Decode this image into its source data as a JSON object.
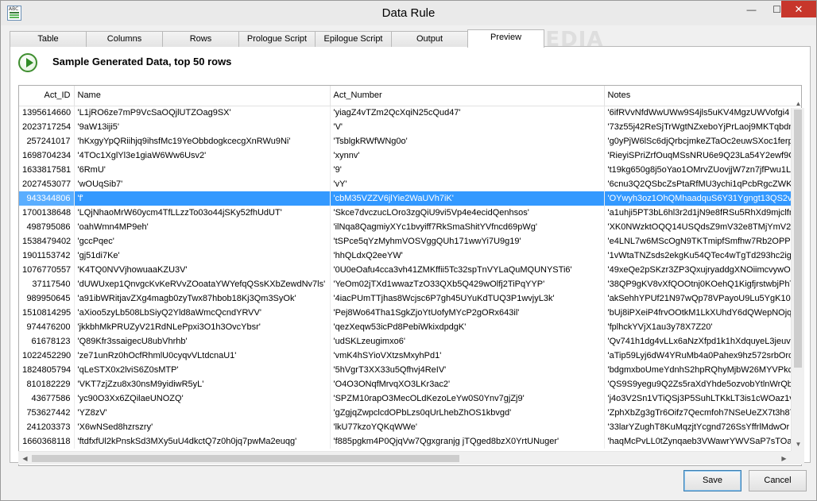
{
  "window": {
    "title": "Data Rule",
    "icon": "abc-grid-icon",
    "controls": {
      "minimize": "—",
      "maximize": "☐",
      "close": "✕"
    }
  },
  "tabs": [
    {
      "label": "Table",
      "active": false
    },
    {
      "label": "Columns",
      "active": false
    },
    {
      "label": "Rows",
      "active": false
    },
    {
      "label": "Prologue Script",
      "active": false
    },
    {
      "label": "Epilogue Script",
      "active": false
    },
    {
      "label": "Output",
      "active": false
    },
    {
      "label": "Preview",
      "active": true
    }
  ],
  "watermark": "SOFTPEDIA",
  "preview": {
    "header_title": "Sample Generated Data, top 50 rows"
  },
  "grid": {
    "columns": [
      "Act_ID",
      "Name",
      "Act_Number",
      "Notes"
    ],
    "selected_row": 6,
    "rows": [
      [
        "1395614660",
        "'L1jRO6ze7mP9VcSaOQjlUTZOag9SX'",
        "'yiagZ4vTZm2QcXqiN25cQud47'",
        "'6ifRVvNfdWwUWw9S4jls5uKV4MgzUWVofgi4"
      ],
      [
        "2023717254",
        "'9aW13iji5'",
        "'V'",
        "'73z55j42ReSjTrWgtNZxeboYjPrLaoj9MKTqbdmc"
      ],
      [
        "257241017",
        "'hKxgyYpQRiihjq9ihsfMc19YeObbdogkcecgXnRWu9Ni'",
        "'TsblgkRWfWNg0o'",
        "'g0yPjW6lSc6djQrbcjmkeZTaOc2euwSXoc1ferp3"
      ],
      [
        "1698704234",
        "'4TOc1XglYl3e1giaW6Ww6Usv2'",
        "'xynnv'",
        "'RieyiSPriZrfOuqMSsNRU6e9Q23La54Y2ewf9O"
      ],
      [
        "1633817581",
        "'6RmU'",
        "'9'",
        "'t19kg650g8j5oYao1OMrvZUovjjW7zn7jfPwu1LK"
      ],
      [
        "2027453077",
        "'wOUqSib7'",
        "'vY'",
        "'6cnu3Q2QSbcZsPtaRfMU3ychi1qPcbRgcZWKc"
      ],
      [
        "943344806",
        "'f'",
        "'cbM35VZZV6jlYie2WaUVh7iK'",
        "'OYwyh3oz1OhQMhaadquS6Y31Ygngt13QS2v"
      ],
      [
        "1700138648",
        "'LQjNhaoMrW60ycm4TfLLzzTo03o44jSKy52fhUdUT'",
        "'Skce7dvczucLOro3zgQiU9vi5Vp4e4ecidQenhsos'",
        "'a1uhji5PT3bL6hl3r2d1jN9e8fRSu5RhXd9mjclfm4"
      ],
      [
        "498795086",
        "'oahWmn4MP9eh'",
        "'ilNqa8QagmiyXYc1bvyiff7RkSmaShitYVfncd69pWg'",
        "'XK0NWzktOQQ14USQdsZ9mV32e8TMjYmV2s"
      ],
      [
        "1538479402",
        "'gccPqec'",
        "'tSPce5qYzMyhmVOSVggQUh171wwYi7U9g19'",
        "'e4LNL7w6MScOgN9TKTmipfSmfhw7Rb2OPPa9"
      ],
      [
        "1901153742",
        "'gj51di7Ke'",
        "'hhQLdxQ2eeYW'",
        "'1vWtaTNZsds2ekgKu54QTec4wTgTd293hc2igK"
      ],
      [
        "1076770557",
        "'K4TQ0NVVjhowuaaKZU3V'",
        "'0U0eOafu4cca3vh41ZMKffii5Tc32spTnVYLaQuMQUNYSTi6'",
        "'49xeQe2pSKzr3ZP3QxujryaddgXNOiimcvywOx"
      ],
      [
        "37117540",
        "'dUWUxep1QnvgcKvKeRVvZOoataYWYefqQSsKXbZewdNv7ls'",
        "'YeOm02jTXd1wwazTzO33QXb5Q429wOlfj2TiPqYYP'",
        "'38QP9gKV8vXfQOOtnj0KOehQ1KigfjrstwbjPhT"
      ],
      [
        "989950645",
        "'a91ibWRitjavZXg4magb0zyTwx87hbob18Kj3Qm3SyOk'",
        "'4iacPUmTTjhas8Wcjsc6P7gh45UYuKdTUQ3P1wvjyL3k'",
        "'akSehhYPUf21N97wQp78VPayoU9Lu5YgK108"
      ],
      [
        "1510814295",
        "'aXioo5zyLb508LbSiyQ2Yld8aWmcQcndYRVV'",
        "'Pej8Wo64Tha1SgkZjoYtUofyMYcP2gORx643il'",
        "'bUj8iPXeiP4frvOOtkM1LkXUhdY6dQWepNOjqS"
      ],
      [
        "974476200",
        "'jkkbhMkPRUZyV21RdNLePpxi3O1h3OvcYbsr'",
        "'qezXeqw53icPd8PebiWkixdpdgK'",
        "'fplhckYVjX1au3y78X7Z20'"
      ],
      [
        "61678123",
        "'Q89Kfr3ssaigecU8ubVhrhb'",
        "'udSKLzeugimxo6'",
        "'Qv741h1dg4vLLx6aNzXfpd1k1hXdquyeL3jeuve"
      ],
      [
        "1022452290",
        "'ze71unRz0hOcfRhmlU0cyqvVLtdcnaU1'",
        "'vmK4hSYioVXtzsMxyhPd1'",
        "'aTip59Lyj6dW4YRuMb4a0Pahex9hz572srbOrdZ"
      ],
      [
        "1824805794",
        "'qLeSTX0x2lviS6Z0sMTP'",
        "'5hVgrT3XX33u5Qfhvj4ReIV'",
        "'bdgmxboUmeYdnhS2hpRQhyMjbW26MYVPkcjj"
      ],
      [
        "810182229",
        "'VKT7zjZzu8x30nsM9yidiwR5yL'",
        "'O4O3ONqfMrvqXO3LKr3ac2'",
        "'QS9S9yegu9Q2Zs5raXdYhde5ozvobYtlnWrQb"
      ],
      [
        "43677586",
        "'yc90O3Xx6ZQilaeUNOZQ'",
        "'SPZM10rapO3MecOLdKezoLeYw0S0Ynv7gjZj9'",
        "'j4o3V2Sn1VTiQSj3P5SuhLTKkLT3is1cWOaz1vP"
      ],
      [
        "753627442",
        "'YZ8zV'",
        "'gZgjqZwpclcdOPbLzs0qUrLhebZhOS1kbvgd'",
        "'ZphXbZg3gTr6Oifz7Qecmfoh7NSeUeZX7t3h87"
      ],
      [
        "241203373",
        "'X6wNSed8hzrszry'",
        "'lkU77kzoYQKqWWe'",
        "'33larYZughT8KuMqzjtYcgnd726SsYffrlMdwOr"
      ],
      [
        "1660368118",
        "'ftdfxfUl2kPnskSd3MXy5uU4dkctQ7z0h0jq7pwMa2euqg'",
        "'f885pgkm4P0QjqVw7Qgxgranjg jTQged8bzX0YrtUNuger'",
        "'haqMcPvLL0tZynqaeb3VWawrYWVSaP7sTOa"
      ]
    ]
  },
  "buttons": {
    "save": "Save",
    "cancel": "Cancel"
  },
  "colors": {
    "selection": "#3399ff",
    "play_icon": "#2f8a25",
    "close_button": "#c7362b"
  }
}
